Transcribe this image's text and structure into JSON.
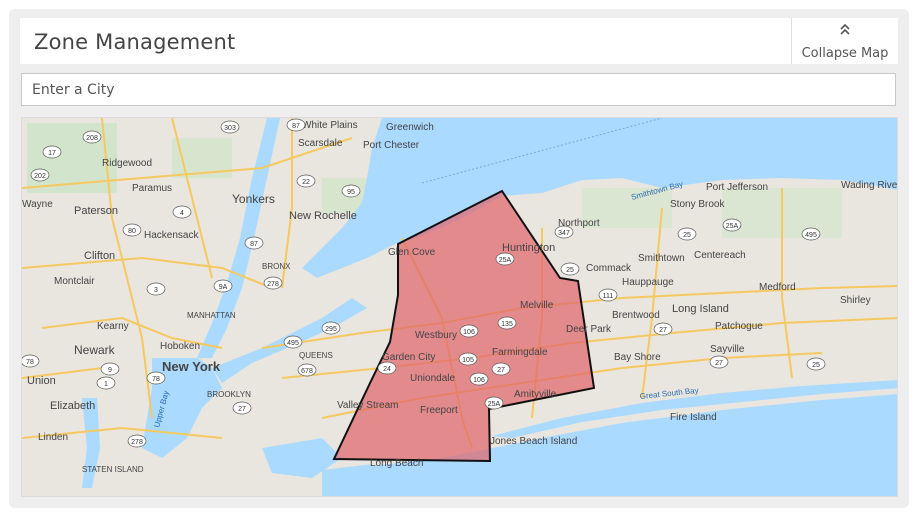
{
  "header": {
    "title": "Zone Management",
    "collapse_label": "Collapse Map"
  },
  "search": {
    "placeholder": "Enter a City"
  },
  "colors": {
    "water": "#aadaff",
    "land": "#e8e6df",
    "zone_fill": "#e0676e",
    "zone_stroke": "#111111",
    "road": "#f6c860"
  },
  "icons": [
    "chevron-double-up-icon"
  ],
  "map": {
    "labels": {
      "white_plains": "White Plains",
      "greenwich": "Greenwich",
      "scarsdale": "Scarsdale",
      "port_chester": "Port Chester",
      "ridgewood": "Ridgewood",
      "paramus": "Paramus",
      "yonkers": "Yonkers",
      "new_rochelle": "New Rochelle",
      "wayne": "Wayne",
      "paterson": "Paterson",
      "hackensack": "Hackensack",
      "clifton": "Clifton",
      "montclair": "Montclair",
      "bronx": "BRONX",
      "manhattan": "MANHATTAN",
      "kearny": "Kearny",
      "hoboken": "Hoboken",
      "newark": "Newark",
      "new_york": "New York",
      "queens": "QUEENS",
      "union": "Union",
      "brooklyn": "BROOKLYN",
      "elizabeth": "Elizabeth",
      "upper_bay": "Upper Bay",
      "linden": "Linden",
      "staten_island": "STATEN ISLAND",
      "glen_cove": "Glen Cove",
      "huntington": "Huntington",
      "northport": "Northport",
      "commack": "Commack",
      "smithtown_bay": "Smithtown Bay",
      "port_jefferson": "Port Jefferson",
      "wading_river": "Wading River",
      "stony_brook": "Stony Brook",
      "smithtown": "Smithtown",
      "centereach": "Centereach",
      "hauppauge": "Hauppauge",
      "medford": "Medford",
      "shirley": "Shirley",
      "melville": "Melville",
      "westbury": "Westbury",
      "deer_park": "Deer Park",
      "brentwood": "Brentwood",
      "long_island": "Long Island",
      "patchogue": "Patchogue",
      "garden_city": "Garden City",
      "farmingdale": "Farmingdale",
      "bay_shore": "Bay Shore",
      "sayville": "Sayville",
      "uniondale": "Uniondale",
      "amityville": "Amityville",
      "great_south_bay": "Great South Bay",
      "valley_stream": "Valley Stream",
      "freeport": "Freeport",
      "fire_island": "Fire Island",
      "jones_beach_island": "Jones Beach Island",
      "long_beach": "Long Beach"
    },
    "routes": [
      "303",
      "87",
      "208",
      "17",
      "202",
      "22",
      "4",
      "95",
      "80",
      "87",
      "3",
      "9A",
      "278",
      "295",
      "495",
      "78",
      "9",
      "1",
      "78",
      "678",
      "27",
      "278",
      "24",
      "106",
      "25A",
      "25",
      "135",
      "105",
      "106",
      "27",
      "25A",
      "347",
      "25A",
      "25",
      "495",
      "111",
      "27",
      "27",
      "25"
    ]
  }
}
